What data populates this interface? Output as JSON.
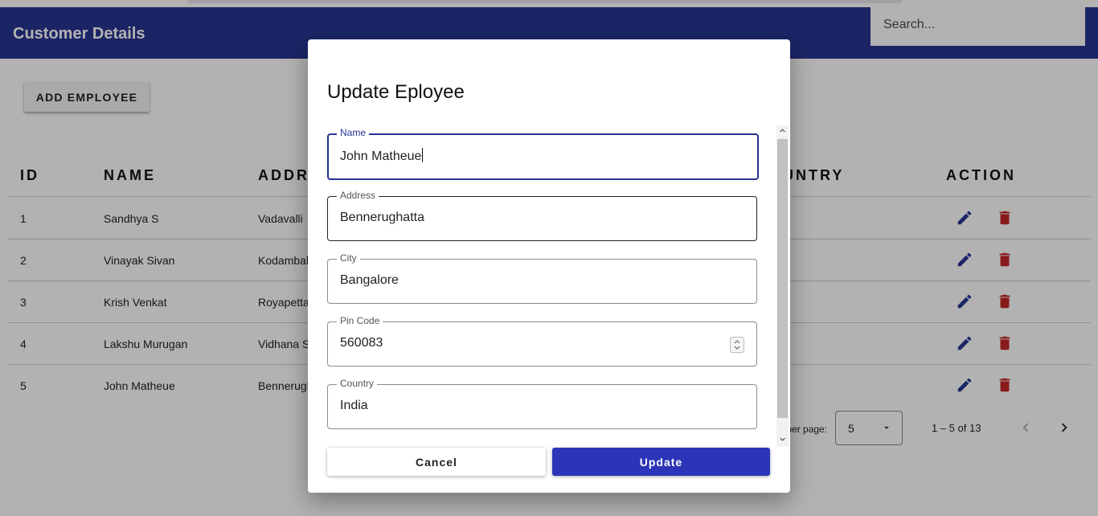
{
  "app": {
    "title": "Customer Details"
  },
  "search": {
    "placeholder": "Search..."
  },
  "toolbar": {
    "add_label": "ADD EMPLOYEE"
  },
  "table": {
    "headers": {
      "id": "ID",
      "name": "NAME",
      "address": "ADDRESS",
      "country": "COUNTRY",
      "action": "ACTION"
    },
    "rows": [
      {
        "id": "1",
        "name": "Sandhya S",
        "address": "Vadavalli"
      },
      {
        "id": "2",
        "name": "Vinayak Sivan",
        "address": "Kodambakkam"
      },
      {
        "id": "3",
        "name": "Krish Venkat",
        "address": "Royapettah"
      },
      {
        "id": "4",
        "name": "Lakshu Murugan",
        "address": "Vidhana Soudha"
      },
      {
        "id": "5",
        "name": "John Matheue",
        "address": "Bennerughatta"
      }
    ]
  },
  "pagination": {
    "rows_per_page_label": "Rows per page:",
    "rows_per_page": "5",
    "range": "1 – 5 of 13"
  },
  "dialog": {
    "title": "Update Eployee",
    "fields": {
      "name": {
        "label": "Name",
        "value": "John Matheue"
      },
      "address": {
        "label": "Address",
        "value": "Bennerughatta"
      },
      "city": {
        "label": "City",
        "value": "Bangalore"
      },
      "pincode": {
        "label": "Pin Code",
        "value": "560083"
      },
      "country": {
        "label": "Country",
        "value": "India"
      }
    },
    "cancel_label": "Cancel",
    "update_label": "Update"
  },
  "colors": {
    "primary": "#283593",
    "update_button": "#2c35b8",
    "delete": "#c62828",
    "edit": "#283593"
  },
  "icons": {
    "edit": "pencil-icon",
    "delete": "trash-icon",
    "prev": "chevron-left-icon",
    "next": "chevron-right-icon",
    "select": "caret-down-icon"
  }
}
